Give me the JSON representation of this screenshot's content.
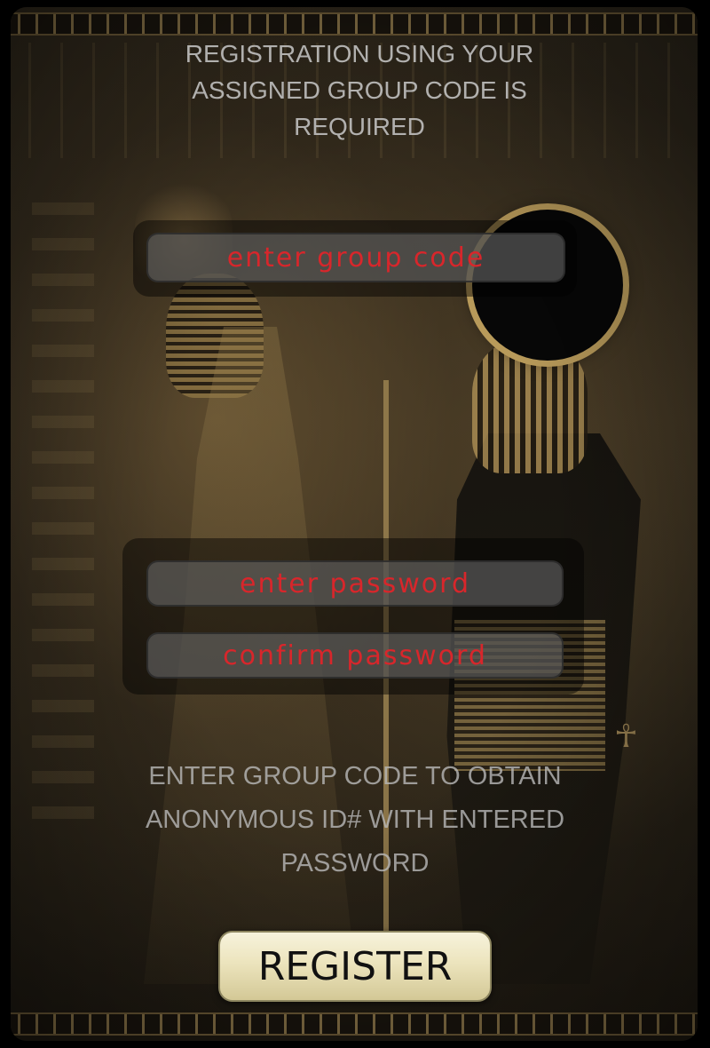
{
  "header": {
    "text": "REGISTRATION USING YOUR ASSIGNED GROUP CODE IS REQUIRED"
  },
  "form": {
    "group_code_placeholder": "enter group code",
    "password_placeholder": "enter password",
    "confirm_placeholder": "confirm password"
  },
  "info": {
    "text": "ENTER GROUP CODE TO OBTAIN ANONYMOUS ID# WITH ENTERED PASSWORD"
  },
  "register": {
    "label": "REGISTER"
  },
  "colors": {
    "placeholder_red": "#d8262b",
    "button_cream": "#ece4bd",
    "text_grey": "#c9c9c9"
  }
}
